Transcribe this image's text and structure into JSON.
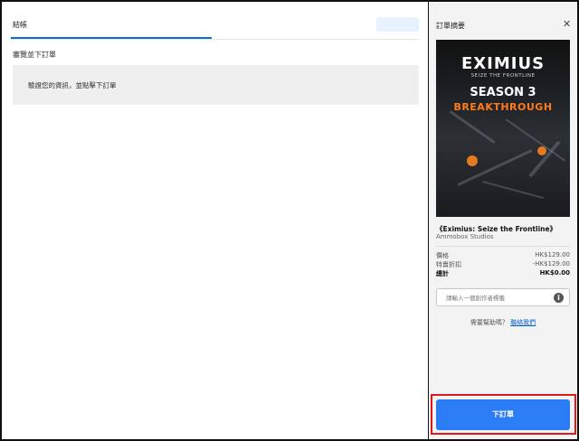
{
  "checkout": {
    "title": "結帳",
    "subtitle": "審覽並下訂單",
    "notice": "驗證您的資訊，並點擊下訂單"
  },
  "summary": {
    "title": "訂單摘要",
    "close_icon": "close-icon",
    "cover": {
      "logo": "EXIMIUS",
      "tagline": "SEIZE THE FRONTLINE",
      "season": "SEASON 3",
      "subtitle": "BREAKTHROUGH"
    },
    "game_name": "《Eximius: Seize the Frontline》",
    "studio": "Ammobox Studios",
    "price_label": "價格",
    "price_value": "HK$129.00",
    "discount_label": "特賣折扣",
    "discount_value": "-HK$129.00",
    "total_label": "總計",
    "total_value": "HK$0.00",
    "creator_placeholder": "請輸入一個創作者標籤",
    "help_text": "需要幫助嗎？",
    "help_link": "聯絡我們",
    "place_order": "下訂單"
  },
  "colors": {
    "accent": "#2c7cf6",
    "highlight": "#e3161b"
  }
}
